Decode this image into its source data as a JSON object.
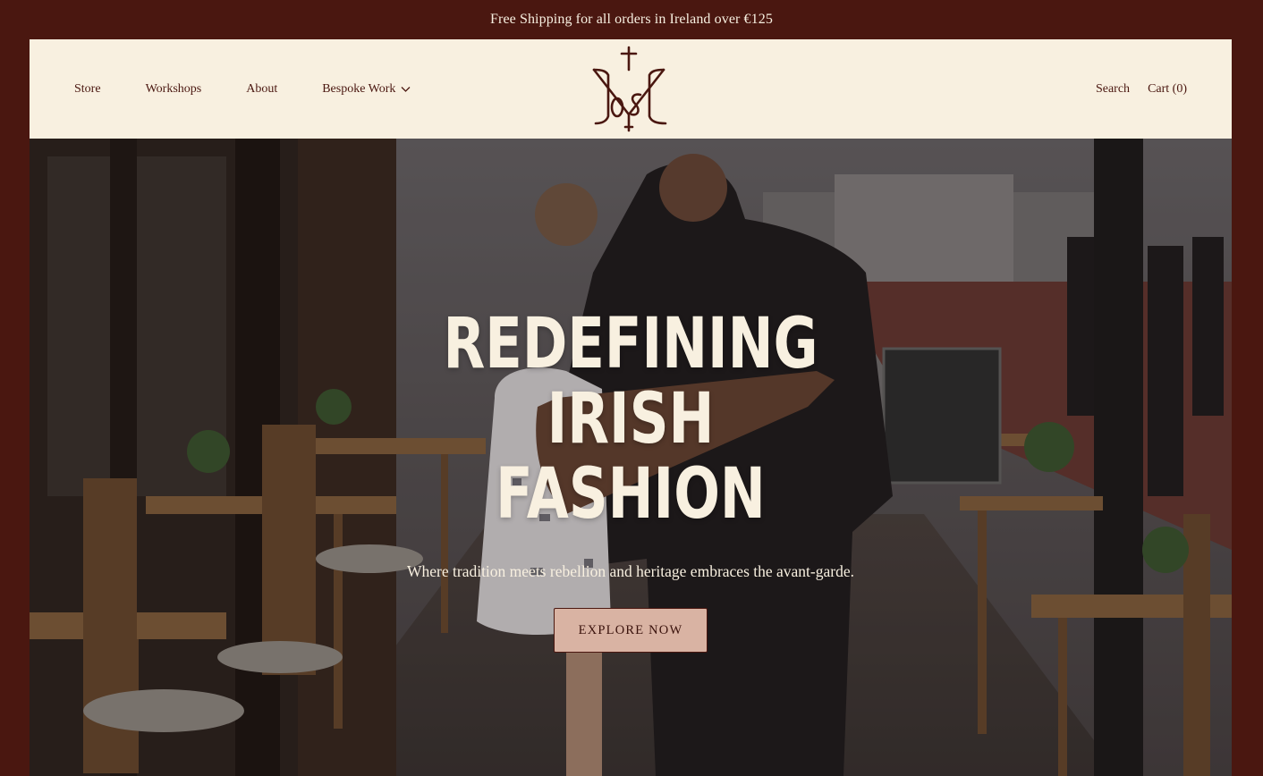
{
  "announcement": {
    "text": "Free Shipping for all orders in Ireland over €125"
  },
  "header": {
    "nav_left": [
      {
        "label": "Store"
      },
      {
        "label": "Workshops"
      },
      {
        "label": "About"
      },
      {
        "label": "Bespoke Work",
        "icon": "chevron-down-icon"
      }
    ],
    "logo": {
      "icon": "monogram-cross-logo"
    },
    "nav_right": [
      {
        "label": "Search"
      },
      {
        "label": "Cart (0)"
      }
    ]
  },
  "hero": {
    "title_line1": "REDEFINING IRISH",
    "title_line2": "FASHION",
    "subtitle": "Where tradition meets rebellion and heritage embraces the avant-garde.",
    "cta_label": "EXPLORE NOW"
  },
  "colors": {
    "frame": "#4a1710",
    "header_bg": "#f8f0e0",
    "cta_bg": "#d9b3a3",
    "text_light": "#f8f0e0"
  }
}
